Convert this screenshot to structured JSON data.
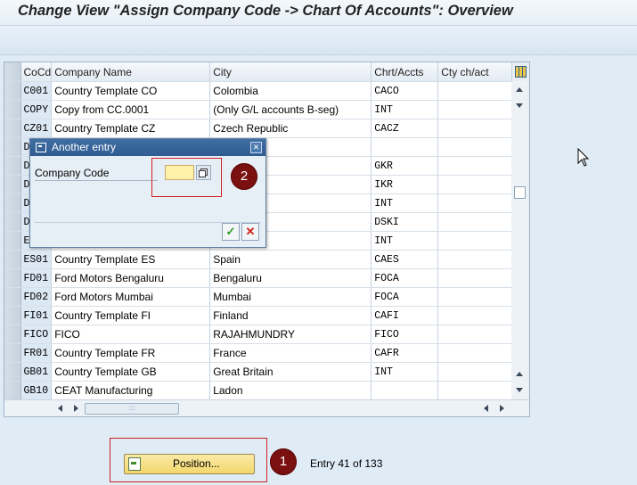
{
  "window": {
    "title": "Change View \"Assign Company Code -> Chart Of Accounts\": Overview"
  },
  "table": {
    "columns": [
      "CoCd",
      "Company Name",
      "City",
      "Chrt/Accts",
      "Cty ch/act"
    ],
    "rows": [
      {
        "cocd": "C001",
        "name": "Country Template CO",
        "city": "Colombia",
        "chart": "CACO",
        "cty": ""
      },
      {
        "cocd": "COPY",
        "name": "Copy from CC.0001",
        "city": "(Only G/L accounts B-seg)",
        "chart": "INT",
        "cty": ""
      },
      {
        "cocd": "CZ01",
        "name": "Country Template CZ",
        "city": "Czech Republic",
        "chart": "CACZ",
        "cty": ""
      },
      {
        "cocd": "D",
        "name": "",
        "city": "",
        "chart": "",
        "cty": ""
      },
      {
        "cocd": "D",
        "name": "",
        "city": "",
        "chart": "GKR",
        "cty": ""
      },
      {
        "cocd": "D",
        "name": "",
        "city": "",
        "chart": "IKR",
        "cty": ""
      },
      {
        "cocd": "D",
        "name": "",
        "city": "",
        "chart": "INT",
        "cty": ""
      },
      {
        "cocd": "D",
        "name": "",
        "city": "",
        "chart": "DSKI",
        "cty": ""
      },
      {
        "cocd": "E",
        "name": "",
        "city": "",
        "chart": "INT",
        "cty": ""
      },
      {
        "cocd": "ES01",
        "name": "Country Template ES",
        "city": "Spain",
        "chart": "CAES",
        "cty": ""
      },
      {
        "cocd": "FD01",
        "name": "Ford Motors Bengaluru",
        "city": "Bengaluru",
        "chart": "FOCA",
        "cty": ""
      },
      {
        "cocd": "FD02",
        "name": "Ford Motors Mumbai",
        "city": "Mumbai",
        "chart": "FOCA",
        "cty": ""
      },
      {
        "cocd": "FI01",
        "name": "Country Template FI",
        "city": "Finland",
        "chart": "CAFI",
        "cty": ""
      },
      {
        "cocd": "FICO",
        "name": "FICO",
        "city": "RAJAHMUNDRY",
        "chart": "FICO",
        "cty": ""
      },
      {
        "cocd": "FR01",
        "name": "Country Template FR",
        "city": "France",
        "chart": "CAFR",
        "cty": ""
      },
      {
        "cocd": "GB01",
        "name": "Country Template GB",
        "city": "Great Britain",
        "chart": "INT",
        "cty": ""
      },
      {
        "cocd": "GB10",
        "name": "CEAT Manufacturing",
        "city": "Ladon",
        "chart": "",
        "cty": ""
      }
    ]
  },
  "dialog": {
    "title": "Another entry",
    "field_label": "Company Code",
    "field_value": ""
  },
  "annotations": {
    "badge1": "1",
    "badge2": "2"
  },
  "footer": {
    "position_button": "Position...",
    "entry_info": "Entry 41 of 133"
  }
}
